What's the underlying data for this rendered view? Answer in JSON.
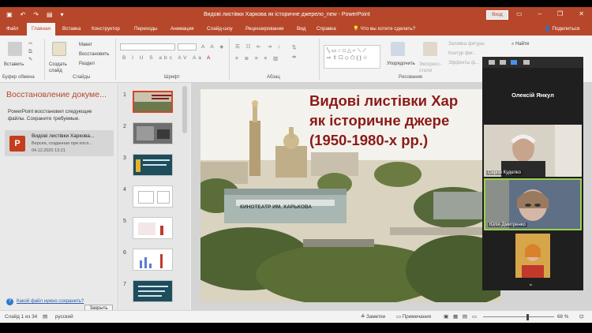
{
  "titlebar": {
    "doc_title": "Видові листівки Харкова як історичне джерело_new  -  PowerPoint",
    "signin": "Вход",
    "qa_icons": [
      "save-icon",
      "undo-icon",
      "redo-icon",
      "present-icon"
    ]
  },
  "tabs": [
    "Файл",
    "Главная",
    "Вставка",
    "Конструктор",
    "Переходы",
    "Анимация",
    "Слайд-шоу",
    "Рецензирование",
    "Вид",
    "Справка"
  ],
  "tell_me": "Что вы хотите сделать?",
  "share": "Поделиться",
  "ribbon": {
    "paste": "Вставить",
    "clipboard_group": "Буфер обмена",
    "new_slide": "Создать слайд",
    "layout": "Макет",
    "reset": "Восстановить",
    "section": "Раздел",
    "slides_group": "Слайды",
    "font_group": "Шрифт",
    "paragraph_group": "Абзац",
    "arrange": "Упорядочить",
    "quick_styles": "Экспресс-стили",
    "shape_fill": "Заливка фигуры",
    "shape_outline": "Контур фиг...",
    "shape_effects": "Эффекты ф...",
    "drawing_group": "Рисование",
    "find": "Найти"
  },
  "recovery": {
    "heading": "Восстановление докуме...",
    "message": "PowerPoint восстановил следующие файлы.  Сохраните требуемые.",
    "file_name": "Видові листівки Харкова...",
    "file_desc": "Версия, созданная при посл...",
    "file_date": "04.12.2020 13:21",
    "question": "Какой файл нужно сохранить?",
    "close": "Закрыть"
  },
  "thumbnails": {
    "numbers": [
      "1",
      "2",
      "3",
      "4",
      "5",
      "6",
      "7"
    ],
    "selected": "1"
  },
  "slide": {
    "title_lines": [
      "Видові листівки Хар",
      "як історичне джере",
      "(1950-1980-х рр.)"
    ],
    "sign_text": "КИНОТЕАТР ИМ. ХАРЬКОВА"
  },
  "zoom": {
    "host": "Олексій Янкул",
    "participants": [
      {
        "name": "Сергій Куделко"
      },
      {
        "name": "Юлія Дмитренко"
      }
    ]
  },
  "status": {
    "slide_info": "Слайд 1 из 34",
    "language": "русский",
    "notes": "Заметки",
    "comments": "Примечания",
    "zoom_level": "68 %"
  },
  "colors": {
    "accent": "#b7472a",
    "title_text": "#8b1a1a"
  }
}
